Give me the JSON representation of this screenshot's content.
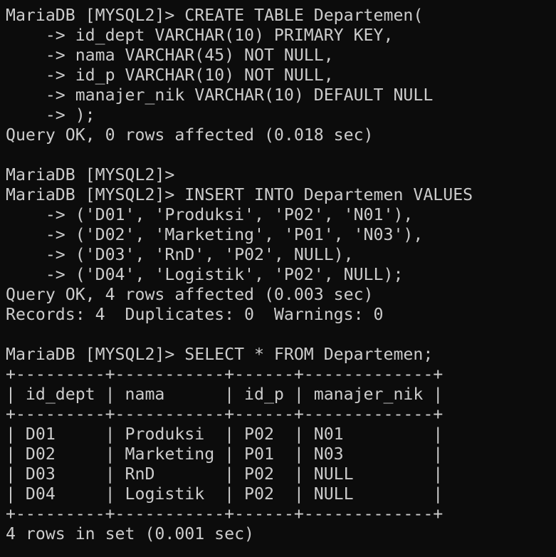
{
  "terminal": {
    "foreground": "#cccccc",
    "background": "#0c0c0c",
    "lines": [
      "MariaDB [MYSQL2]> CREATE TABLE Departemen(",
      "    -> id_dept VARCHAR(10) PRIMARY KEY,",
      "    -> nama VARCHAR(45) NOT NULL,",
      "    -> id_p VARCHAR(10) NOT NULL,",
      "    -> manajer_nik VARCHAR(10) DEFAULT NULL",
      "    -> );",
      "Query OK, 0 rows affected (0.018 sec)",
      "",
      "MariaDB [MYSQL2]>",
      "MariaDB [MYSQL2]> INSERT INTO Departemen VALUES",
      "    -> ('D01', 'Produksi', 'P02', 'N01'),",
      "    -> ('D02', 'Marketing', 'P01', 'N03'),",
      "    -> ('D03', 'RnD', 'P02', NULL),",
      "    -> ('D04', 'Logistik', 'P02', NULL);",
      "Query OK, 4 rows affected (0.003 sec)",
      "Records: 4  Duplicates: 0  Warnings: 0",
      "",
      "MariaDB [MYSQL2]> SELECT * FROM Departemen;",
      "+---------+-----------+------+-------------+",
      "| id_dept | nama      | id_p | manajer_nik |",
      "+---------+-----------+------+-------------+",
      "| D01     | Produksi  | P02  | N01         |",
      "| D02     | Marketing | P01  | N03         |",
      "| D03     | RnD       | P02  | NULL        |",
      "| D04     | Logistik  | P02  | NULL        |",
      "+---------+-----------+------+-------------+",
      "4 rows in set (0.001 sec)"
    ]
  }
}
